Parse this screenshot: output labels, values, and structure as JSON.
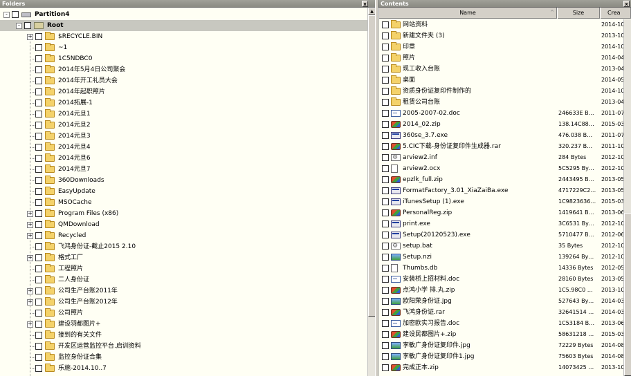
{
  "left_pane": {
    "title": "Folders",
    "close_glyph": "x",
    "tree": [
      {
        "depth": 0,
        "label": "Partition4",
        "icon": "drive-icon",
        "expander": "-",
        "bold": true
      },
      {
        "depth": 1,
        "label": "Root",
        "icon": "root-icon",
        "expander": "-",
        "bold": true,
        "selected": true
      },
      {
        "depth": 2,
        "label": "$RECYCLE.BIN",
        "icon": "folder-icon",
        "expander": "+"
      },
      {
        "depth": 2,
        "label": "~1",
        "icon": "folder-icon"
      },
      {
        "depth": 2,
        "label": "1C5NDBC0",
        "icon": "folder-icon"
      },
      {
        "depth": 2,
        "label": "2014年5月4日公司聚会",
        "icon": "folder-icon"
      },
      {
        "depth": 2,
        "label": "2014年开工礼员大会",
        "icon": "folder-icon"
      },
      {
        "depth": 2,
        "label": "2014年起职照片",
        "icon": "folder-icon"
      },
      {
        "depth": 2,
        "label": "2014拓展-1",
        "icon": "folder-icon"
      },
      {
        "depth": 2,
        "label": "2014元旦1",
        "icon": "folder-icon"
      },
      {
        "depth": 2,
        "label": "2014元旦2",
        "icon": "folder-icon"
      },
      {
        "depth": 2,
        "label": "2014元旦3",
        "icon": "folder-icon"
      },
      {
        "depth": 2,
        "label": "2014元旦4",
        "icon": "folder-icon"
      },
      {
        "depth": 2,
        "label": "2014元旦6",
        "icon": "folder-icon"
      },
      {
        "depth": 2,
        "label": "2014元旦7",
        "icon": "folder-icon"
      },
      {
        "depth": 2,
        "label": "360Downloads",
        "icon": "folder-icon"
      },
      {
        "depth": 2,
        "label": "EasyUpdate",
        "icon": "folder-icon"
      },
      {
        "depth": 2,
        "label": "MSOCache",
        "icon": "folder-icon"
      },
      {
        "depth": 2,
        "label": "Program Files (x86)",
        "icon": "folder-icon",
        "expander": "+"
      },
      {
        "depth": 2,
        "label": "QMDownload",
        "icon": "folder-icon",
        "expander": "+"
      },
      {
        "depth": 2,
        "label": "Recycled",
        "icon": "folder-icon",
        "expander": "+"
      },
      {
        "depth": 2,
        "label": "飞鸿身份证-截止2015 2.10",
        "icon": "folder-icon"
      },
      {
        "depth": 2,
        "label": "格式工厂",
        "icon": "folder-icon",
        "expander": "+"
      },
      {
        "depth": 2,
        "label": "工程照片",
        "icon": "folder-icon"
      },
      {
        "depth": 2,
        "label": "二人身份证",
        "icon": "folder-icon"
      },
      {
        "depth": 2,
        "label": "公司生产台账2011年",
        "icon": "folder-icon",
        "expander": "+"
      },
      {
        "depth": 2,
        "label": "公司生产台账2012年",
        "icon": "folder-icon",
        "expander": "+"
      },
      {
        "depth": 2,
        "label": "公司照片",
        "icon": "folder-icon"
      },
      {
        "depth": 2,
        "label": "建设羽都图片+",
        "icon": "folder-icon",
        "expander": "+"
      },
      {
        "depth": 2,
        "label": "接到的有关文件",
        "icon": "folder-icon"
      },
      {
        "depth": 2,
        "label": "开发区运营监控平台.启训资料",
        "icon": "folder-icon"
      },
      {
        "depth": 2,
        "label": "监控身份证合集",
        "icon": "folder-icon"
      },
      {
        "depth": 2,
        "label": "乐施-2014.10..7",
        "icon": "folder-icon"
      }
    ]
  },
  "right_pane": {
    "title": "Contents",
    "close_glyph": "x",
    "columns": {
      "name": "Name",
      "size": "Size",
      "created": "Crea"
    },
    "sort_glyph": "^",
    "rows": [
      {
        "name": "网站资料",
        "size": "",
        "created": "2014-10",
        "icon": "folder-icon"
      },
      {
        "name": "新建文件夹 (3)",
        "size": "",
        "created": "2013-10",
        "icon": "folder-icon"
      },
      {
        "name": "印章",
        "size": "",
        "created": "2014-10",
        "icon": "folder-icon"
      },
      {
        "name": "照片",
        "size": "",
        "created": "2014-04",
        "icon": "folder-icon"
      },
      {
        "name": "现工收入台账",
        "size": "",
        "created": "2013-04",
        "icon": "folder-icon"
      },
      {
        "name": "桌面",
        "size": "",
        "created": "2014-05",
        "icon": "folder-icon"
      },
      {
        "name": "资质身份证复印件制作的",
        "size": "",
        "created": "2014-10",
        "icon": "folder-icon"
      },
      {
        "name": "租赁公司台账",
        "size": "",
        "created": "2013-04",
        "icon": "folder-icon"
      },
      {
        "name": "2005-2007-02.doc",
        "size": "246633E B…",
        "created": "2011-07",
        "icon": "doc-icon"
      },
      {
        "name": "2014_02.zip",
        "size": "138.14C88…",
        "created": "2015-03",
        "icon": "arch-icon"
      },
      {
        "name": "360se_3.7.exe",
        "size": "476.038 B…",
        "created": "2011-07",
        "icon": "exe-icon"
      },
      {
        "name": "5.CIC下载-身份证复印件生成器.rar",
        "size": "320.237 B…",
        "created": "2011-10",
        "icon": "arch-icon"
      },
      {
        "name": "arview2.inf",
        "size": "284 Bytes",
        "created": "2012-10",
        "icon": "gear-icon"
      },
      {
        "name": "arview2.ocx",
        "size": "5C5295 By…",
        "created": "2012-10",
        "icon": "file-icon"
      },
      {
        "name": "epzlk_full.zip",
        "size": "2443495 B…",
        "created": "2013-05",
        "icon": "arch-icon"
      },
      {
        "name": "FormatFactory_3.01_XiaZaiBa.exe",
        "size": "4717229C2…",
        "created": "2013-05",
        "icon": "exe-icon"
      },
      {
        "name": "iTunesSetup (1).exe",
        "size": "1C9823636…",
        "created": "2015-03",
        "icon": "exe-icon"
      },
      {
        "name": "PersonalReg.zip",
        "size": "1419641 B…",
        "created": "2013-06",
        "icon": "arch-icon"
      },
      {
        "name": "print.exe",
        "size": "3C6531 By…",
        "created": "2012-10",
        "icon": "exe-icon"
      },
      {
        "name": "Setup(20120523).exe",
        "size": "5710477 B…",
        "created": "2012-06",
        "icon": "exe-icon"
      },
      {
        "name": "setup.bat",
        "size": "35 Bytes",
        "created": "2012-10",
        "icon": "gear-icon"
      },
      {
        "name": "Setup.nzi",
        "size": "139264 By…",
        "created": "2012-10",
        "icon": "img-icon"
      },
      {
        "name": "Thumbs.db",
        "size": "14336 Bytes",
        "created": "2012-05",
        "icon": "file-icon"
      },
      {
        "name": "安装桥上招材料.doc",
        "size": "28160 Bytes",
        "created": "2013-05",
        "icon": "doc-icon"
      },
      {
        "name": "点鸿小学 排.丸.zip",
        "size": "1C5.98C0 …",
        "created": "2013-10",
        "icon": "arch-icon"
      },
      {
        "name": "欧阳荣身份证.jpg",
        "size": "527643 By…",
        "created": "2014-03",
        "icon": "img-icon"
      },
      {
        "name": "飞鸿身份证.rar",
        "size": "32641514 …",
        "created": "2014-03",
        "icon": "arch-icon"
      },
      {
        "name": "加密欧实习报告.doc",
        "size": "1C53184 B…",
        "created": "2013-06",
        "icon": "doc-icon"
      },
      {
        "name": "建设民都图片+.zip",
        "size": "58631218 …",
        "created": "2015-03",
        "icon": "arch-icon"
      },
      {
        "name": "李敏广身份证复印件.jpg",
        "size": "72229 Bytes",
        "created": "2014-08",
        "icon": "img-icon"
      },
      {
        "name": "李敏广身份证复印件1.jpg",
        "size": "75603 Bytes",
        "created": "2014-08",
        "icon": "img-icon"
      },
      {
        "name": "完成正本.zip",
        "size": "14073425 …",
        "created": "2013-10",
        "icon": "arch-icon"
      }
    ]
  }
}
